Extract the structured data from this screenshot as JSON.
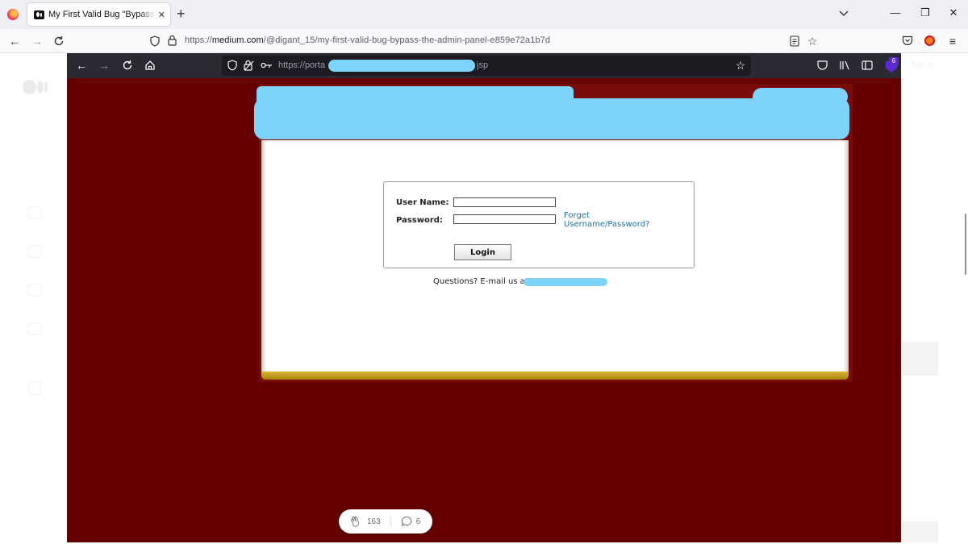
{
  "browser": {
    "tab_title": "My First Valid Bug \"Bypass the Admin Panel\"",
    "tab_close": "✕",
    "new_tab": "+",
    "url_prefix": "https://",
    "url_domain": "medium.com",
    "url_path": "/@digant_15/my-first-valid-bug-bypass-the-admin-panel-e859e72a1b7d",
    "win_minimize": "—",
    "win_restore": "❐",
    "win_close": "✕"
  },
  "medium": {
    "sign_in": "Sign in"
  },
  "embedded": {
    "url_start": "https://porta",
    "url_end": "jsp",
    "extension_badge": "6",
    "login": {
      "username_label": "User Name:",
      "password_label": "Password:",
      "username_value": "",
      "password_value": "",
      "forget_link_line1": "Forget",
      "forget_link_line2": "Username/Password?",
      "login_button": "Login",
      "questions_text": "Questions? E-mail us at"
    }
  },
  "engagement": {
    "claps": "163",
    "responses": "6"
  },
  "colors": {
    "page_maroon": "#650000",
    "redaction": "#7dd3fc",
    "gold_bar": "#c9a227",
    "link": "#1f6fa1"
  }
}
